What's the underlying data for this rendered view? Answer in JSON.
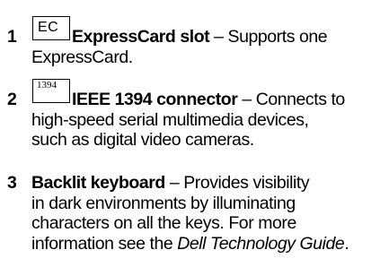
{
  "items": [
    {
      "number": "1",
      "icon": "expresscard-icon",
      "icon_label": "EC",
      "term": "ExpressCard slot",
      "separator": " – ",
      "description_line1": "Supports one",
      "description_line2": "ExpressCard."
    },
    {
      "number": "2",
      "icon": "ieee-1394-icon",
      "icon_label": "1394",
      "term": "IEEE 1394 connector",
      "separator": " – ",
      "description_line1": "Connects to",
      "description_line2": "high-speed serial multimedia devices,",
      "description_line3": "such as digital video cameras."
    },
    {
      "number": "3",
      "term": "Backlit keyboard",
      "separator": " – ",
      "description_line1": "Provides visibility",
      "description_line2": "in dark environments by illuminating",
      "description_line3": "characters on all the keys. For more",
      "description_line4_prefix": "information see the ",
      "guide_title": "Dell Technology Guide",
      "description_line4_suffix": "."
    }
  ]
}
